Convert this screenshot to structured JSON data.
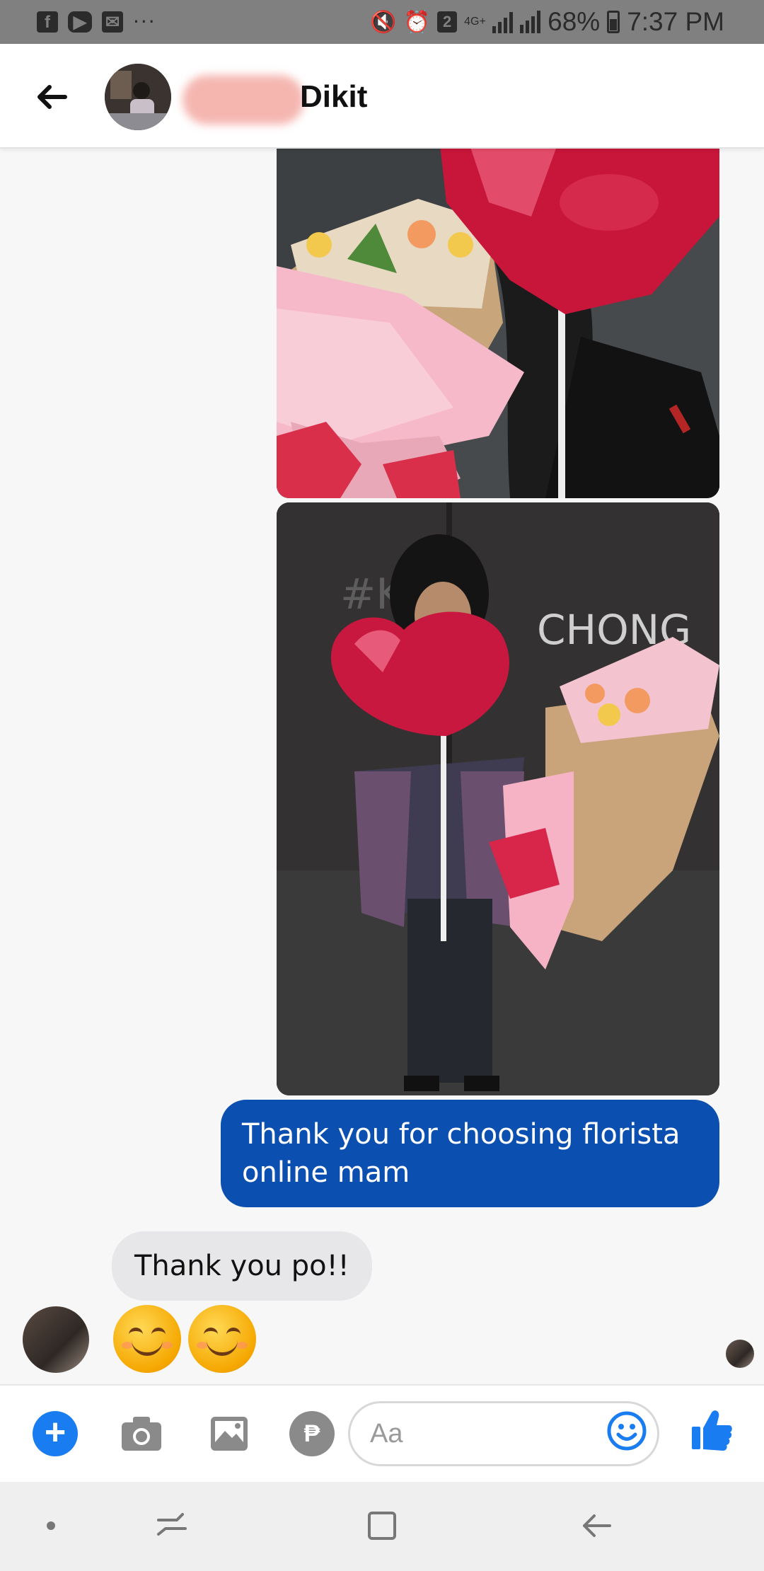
{
  "status_bar": {
    "left_icons": [
      "facebook-icon",
      "youtube-icon",
      "mail-icon"
    ],
    "more": "···",
    "notification_count": "2",
    "network": "4G+",
    "battery": "68%",
    "time": "7:37 PM"
  },
  "header": {
    "contact_name": "Dikit"
  },
  "messages": [
    {
      "direction": "outgoing",
      "type": "image",
      "content": "bouquet-and-heart-balloon-photo"
    },
    {
      "direction": "outgoing",
      "type": "image",
      "content": "woman-holding-bouquet-and-balloon-photo"
    },
    {
      "direction": "outgoing",
      "type": "text",
      "text": "Thank you for choosing florista online mam"
    },
    {
      "direction": "incoming",
      "type": "text",
      "text": "Thank you po!!"
    },
    {
      "direction": "incoming",
      "type": "emoji",
      "text": "😊😊"
    }
  ],
  "composer": {
    "placeholder": "Aa",
    "peso_symbol": "₱"
  },
  "colors": {
    "outgoing_bubble": "#0b4fb0",
    "incoming_bubble": "#e7e7e9",
    "accent": "#1a7cf1",
    "status_bar": "#808080"
  }
}
